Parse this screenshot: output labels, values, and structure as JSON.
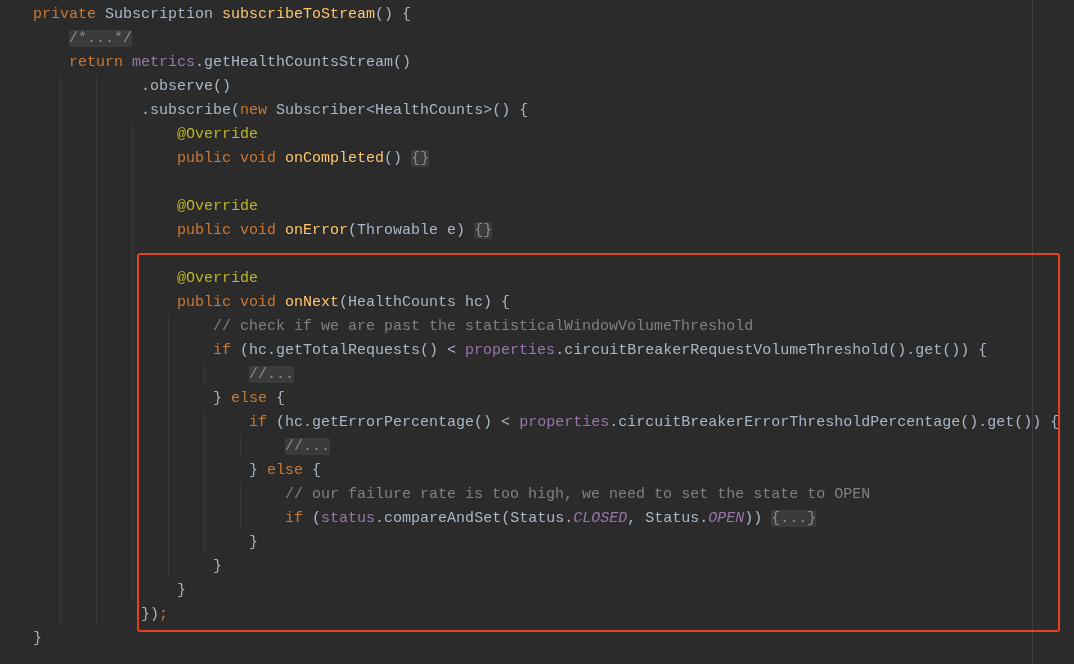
{
  "blocks": [
    {
      "highlighted": false,
      "lines": [
        {
          "tokens": [
            {
              "kind": "keyword",
              "text": "private "
            },
            {
              "kind": "plain",
              "text": "Subscription "
            },
            {
              "kind": "declaration",
              "text": "subscribeToStream"
            },
            {
              "kind": "plain",
              "text": "() {"
            }
          ]
        },
        {
          "tokens": [
            {
              "kind": "folded",
              "text": "    /*...*/"
            }
          ]
        },
        {
          "tokens": [
            {
              "kind": "keyword",
              "text": "    return "
            },
            {
              "kind": "field",
              "text": "metrics"
            },
            {
              "kind": "plain",
              "text": ".getHealthCountsStream()"
            }
          ]
        },
        {
          "tokens": [
            {
              "kind": "plain",
              "text": "            .observe()"
            }
          ]
        },
        {
          "tokens": [
            {
              "kind": "plain",
              "text": "            .subscribe("
            },
            {
              "kind": "keyword",
              "text": "new "
            },
            {
              "kind": "plain",
              "text": "Subscriber<HealthCounts>() {"
            }
          ]
        },
        {
          "tokens": [
            {
              "kind": "annotation",
              "text": "                @Override"
            }
          ]
        },
        {
          "tokens": [
            {
              "kind": "keyword",
              "text": "                public void "
            },
            {
              "kind": "declaration",
              "text": "onCompleted"
            },
            {
              "kind": "plain",
              "text": "() "
            },
            {
              "kind": "folded",
              "text": "{}"
            }
          ]
        },
        {
          "kind": "blank"
        },
        {
          "tokens": [
            {
              "kind": "annotation",
              "text": "                @Override"
            }
          ]
        },
        {
          "tokens": [
            {
              "kind": "keyword",
              "text": "                public void "
            },
            {
              "kind": "declaration",
              "text": "onError"
            },
            {
              "kind": "plain",
              "text": "(Throwable e) "
            },
            {
              "kind": "folded",
              "text": "{}"
            }
          ]
        },
        {
          "kind": "blank"
        }
      ]
    },
    {
      "highlighted": true,
      "lines": [
        {
          "tokens": [
            {
              "kind": "annotation",
              "text": "                @Override"
            }
          ]
        },
        {
          "tokens": [
            {
              "kind": "keyword",
              "text": "                public void "
            },
            {
              "kind": "declaration",
              "text": "onNext"
            },
            {
              "kind": "plain",
              "text": "(HealthCounts hc) {"
            }
          ]
        },
        {
          "tokens": [
            {
              "kind": "comment",
              "text": "                    // check if we are past the statisticalWindowVolumeThreshold"
            }
          ]
        },
        {
          "tokens": [
            {
              "kind": "keyword",
              "text": "                    if "
            },
            {
              "kind": "plain",
              "text": "(hc.getTotalRequests() < "
            },
            {
              "kind": "field",
              "text": "properties"
            },
            {
              "kind": "plain",
              "text": ".circuitBreakerRequestVolumeThreshold().get()) {"
            }
          ]
        },
        {
          "tokens": [
            {
              "kind": "folded",
              "text": "                        //..."
            }
          ]
        },
        {
          "tokens": [
            {
              "kind": "plain",
              "text": "                    } "
            },
            {
              "kind": "keyword",
              "text": "else "
            },
            {
              "kind": "plain",
              "text": "{"
            }
          ]
        },
        {
          "tokens": [
            {
              "kind": "keyword",
              "text": "                        if "
            },
            {
              "kind": "plain",
              "text": "(hc.getErrorPercentage() < "
            },
            {
              "kind": "field",
              "text": "properties"
            },
            {
              "kind": "plain",
              "text": ".circuitBreakerErrorThresholdPercentage().get()) {"
            }
          ]
        },
        {
          "tokens": [
            {
              "kind": "folded",
              "text": "                            //..."
            }
          ]
        },
        {
          "tokens": [
            {
              "kind": "plain",
              "text": "                        } "
            },
            {
              "kind": "keyword",
              "text": "else "
            },
            {
              "kind": "plain",
              "text": "{"
            }
          ]
        },
        {
          "tokens": [
            {
              "kind": "comment",
              "text": "                            // our failure rate is too high, we need to set the state to OPEN"
            }
          ]
        },
        {
          "tokens": [
            {
              "kind": "keyword",
              "text": "                            if "
            },
            {
              "kind": "plain",
              "text": "("
            },
            {
              "kind": "field",
              "text": "status"
            },
            {
              "kind": "plain",
              "text": ".compareAndSet(Status."
            },
            {
              "kind": "constant",
              "text": "CLOSED"
            },
            {
              "kind": "plain",
              "text": ", Status."
            },
            {
              "kind": "constant",
              "text": "OPEN"
            },
            {
              "kind": "plain",
              "text": ")) "
            },
            {
              "kind": "folded",
              "text": "{...}"
            }
          ]
        },
        {
          "tokens": [
            {
              "kind": "plain",
              "text": "                        }"
            }
          ]
        },
        {
          "tokens": [
            {
              "kind": "plain",
              "text": "                    }"
            }
          ]
        },
        {
          "tokens": [
            {
              "kind": "plain",
              "text": "                }"
            }
          ]
        },
        {
          "tokens": [
            {
              "kind": "plain",
              "text": "            })"
            },
            {
              "kind": "keyword",
              "text": ";"
            }
          ]
        }
      ]
    },
    {
      "highlighted": false,
      "lines": [
        {
          "tokens": [
            {
              "kind": "plain",
              "text": "}"
            }
          ]
        }
      ]
    }
  ]
}
